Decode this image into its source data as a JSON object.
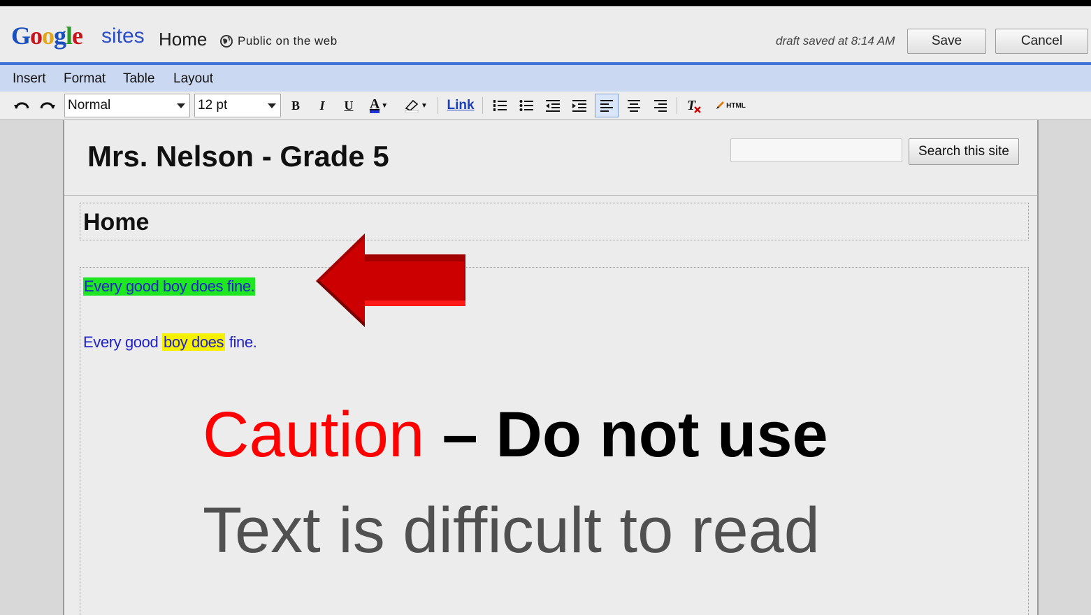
{
  "app": {
    "logo": {
      "g1": "G",
      "o1": "o",
      "o2": "o",
      "g2": "g",
      "l": "l",
      "e": "e"
    },
    "product_name": "sites",
    "page_name": "Home",
    "visibility": "Public on the web",
    "draft_status": "draft saved at 8:14 AM",
    "save_label": "Save",
    "cancel_label": "Cancel"
  },
  "menubar": {
    "items": [
      "Insert",
      "Format",
      "Table",
      "Layout"
    ]
  },
  "toolbar": {
    "style_select": "Normal",
    "size_select": "12 pt",
    "bold": "B",
    "italic": "I",
    "underline": "U",
    "text_color": "A",
    "link_label": "Link",
    "html_label": "HTML"
  },
  "site": {
    "title": "Mrs. Nelson - Grade 5",
    "search_button": "Search this site",
    "search_value": ""
  },
  "page": {
    "heading": "Home",
    "line1": "Every good boy does fine.",
    "line2_part1": "Every good ",
    "line2_highlight": "boy does",
    "line2_part3": " fine."
  },
  "overlay": {
    "caution_word": "Caution",
    "caution_rest": " – Do not use",
    "subtitle": "Text is difficult to read"
  },
  "colors": {
    "accent_blue": "#3f74d4",
    "menubar_bg": "#cbd8f1",
    "green_highlight": "#1ee620",
    "yellow_highlight": "#f4f000",
    "text_blue": "#2222cc",
    "caution_red": "#ff0000",
    "arrow_red": "#cc0000"
  }
}
